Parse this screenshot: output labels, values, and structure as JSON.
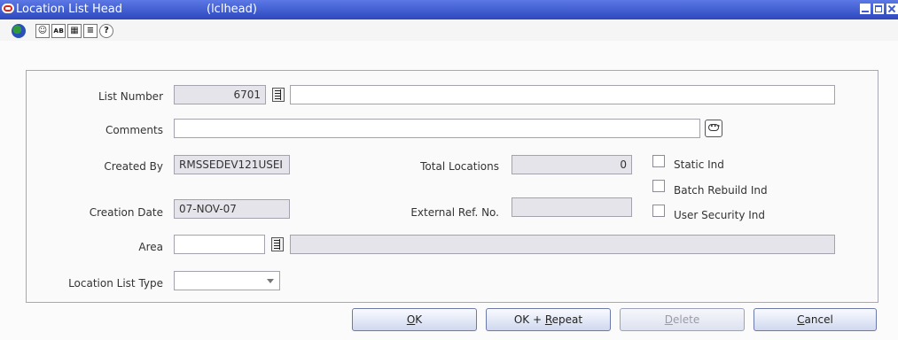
{
  "window": {
    "title": "Location List Head",
    "code": "(lclhead)"
  },
  "toolbar": {
    "icons": [
      "globe-icon",
      "help-icon",
      "spell-check-icon",
      "calendar-icon",
      "notes-icon",
      "question-icon"
    ],
    "glyphs": {
      "help": "☺",
      "spell": "ᴀʙ",
      "calendar": "▦",
      "notes": "≡",
      "question": "?"
    }
  },
  "form": {
    "list_number": {
      "label": "List Number",
      "value": "6701",
      "description": ""
    },
    "comments": {
      "label": "Comments",
      "value": ""
    },
    "created_by": {
      "label": "Created By",
      "value": "RMSSEDEV121USEI"
    },
    "creation_date": {
      "label": "Creation Date",
      "value": "07-NOV-07"
    },
    "total_locations": {
      "label": "Total Locations",
      "value": "0"
    },
    "external_ref": {
      "label": "External Ref. No.",
      "value": ""
    },
    "area": {
      "label": "Area",
      "value": "",
      "description": ""
    },
    "location_list_type": {
      "label": "Location List Type",
      "value": ""
    },
    "static_ind": {
      "label": "Static Ind",
      "checked": false
    },
    "batch_rebuild_ind": {
      "label": "Batch Rebuild Ind",
      "checked": false
    },
    "user_security_ind": {
      "label": "User Security Ind",
      "checked": false
    }
  },
  "buttons": {
    "ok": {
      "mnemonic": "O",
      "rest": "K"
    },
    "ok_repeat": {
      "prefix": "OK + ",
      "mnemonic": "R",
      "rest": "epeat"
    },
    "delete": {
      "mnemonic": "D",
      "rest": "elete",
      "disabled": true
    },
    "cancel": {
      "mnemonic": "C",
      "rest": "ancel"
    }
  },
  "colors": {
    "titlebar": "#3e5cd1",
    "readonly_field": "#e4e4ea",
    "app_logo": "#d8261d"
  }
}
